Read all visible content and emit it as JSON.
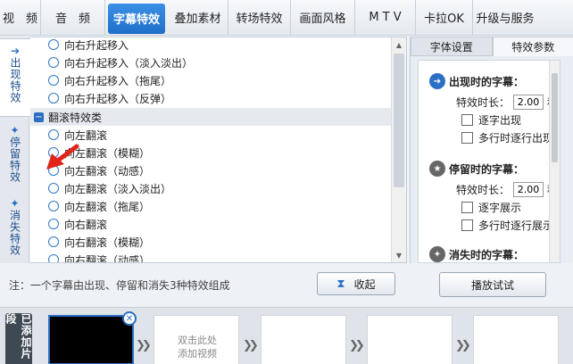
{
  "top_tabs": [
    "视　频",
    "音　频",
    "字幕特效",
    "叠加素材",
    "转场特效",
    "画面风格",
    "M T V",
    "卡拉OK",
    "升级与服务"
  ],
  "vertical_tabs": [
    {
      "label": "出现特效",
      "icon": "enter-arrow-icon"
    },
    {
      "label": "停留特效",
      "icon": "stay-icon"
    },
    {
      "label": "消失特效",
      "icon": "exit-arrow-icon"
    }
  ],
  "list": {
    "items_top": [
      "向右升起移入",
      "向右升起移入（淡入淡出）",
      "向右升起移入（拖尾）",
      "向右升起移入（反弹）"
    ],
    "group_label": "翻滚特效类",
    "items_group": [
      "向左翻滚",
      "向左翻滚（模糊）",
      "向左翻滚（动感）",
      "向左翻滚（淡入淡出）",
      "向左翻滚（拖尾）",
      "向右翻滚",
      "向右翻滚（模糊）",
      "向右翻滚（动感）"
    ]
  },
  "right_panel": {
    "tabs": [
      "字体设置",
      "特效参数"
    ],
    "appear": {
      "title": "出现时的字幕：",
      "duration_label": "特效时长：",
      "duration_value": "2.00",
      "unit": "秒",
      "options": [
        "逐字出现",
        "多行时逐行出现"
      ]
    },
    "stay": {
      "title": "停留时的字幕：",
      "duration_label": "特效时长：",
      "duration_value": "2.00",
      "unit": "秒",
      "options": [
        "逐字展示",
        "多行时逐行展示"
      ]
    },
    "disappear": {
      "title": "消失时的字幕："
    }
  },
  "note": "注：一个字幕由出现、停留和消失3种特效组成",
  "collapse_label": "收起",
  "play_label": "播放试试",
  "timeline": {
    "label": "已添加片段",
    "placeholder_line1": "双击此处",
    "placeholder_line2": "添加视频"
  }
}
